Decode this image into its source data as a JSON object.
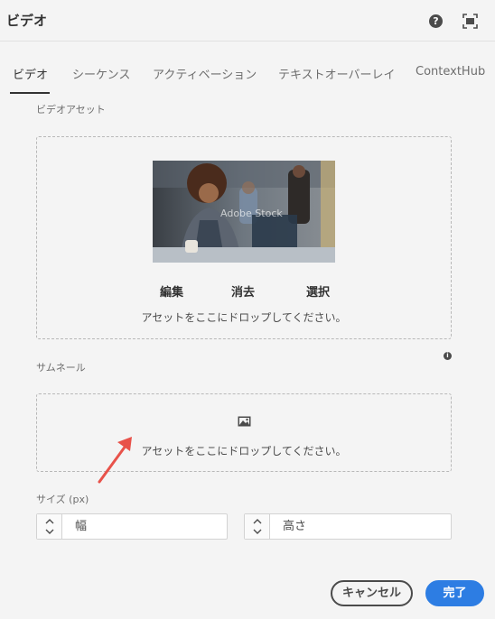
{
  "dialog": {
    "title": "ビデオ",
    "help_icon": "help-icon",
    "fullscreen_icon": "fullscreen-icon"
  },
  "tabs": [
    {
      "label": "ビデオ",
      "active": true
    },
    {
      "label": "シーケンス",
      "active": false
    },
    {
      "label": "アクティベーション",
      "active": false
    },
    {
      "label": "テキストオーバーレイ",
      "active": false
    },
    {
      "label": "ContextHub",
      "active": false
    }
  ],
  "video_asset": {
    "label": "ビデオアセット",
    "watermark": "Adobe Stock",
    "actions": {
      "edit": "編集",
      "clear": "消去",
      "select": "選択"
    },
    "drop_text": "アセットをここにドロップしてください。"
  },
  "thumbnail": {
    "label": "サムネール",
    "info_icon": "info-icon",
    "image_icon": "image-icon",
    "drop_text": "アセットをここにドロップしてください。"
  },
  "size": {
    "label": "サイズ (px)",
    "width_placeholder": "幅",
    "height_placeholder": "高さ"
  },
  "footer": {
    "cancel_label": "キャンセル",
    "done_label": "完了"
  },
  "colors": {
    "accent": "#2d7de3",
    "annotation_arrow": "#e8524a"
  }
}
